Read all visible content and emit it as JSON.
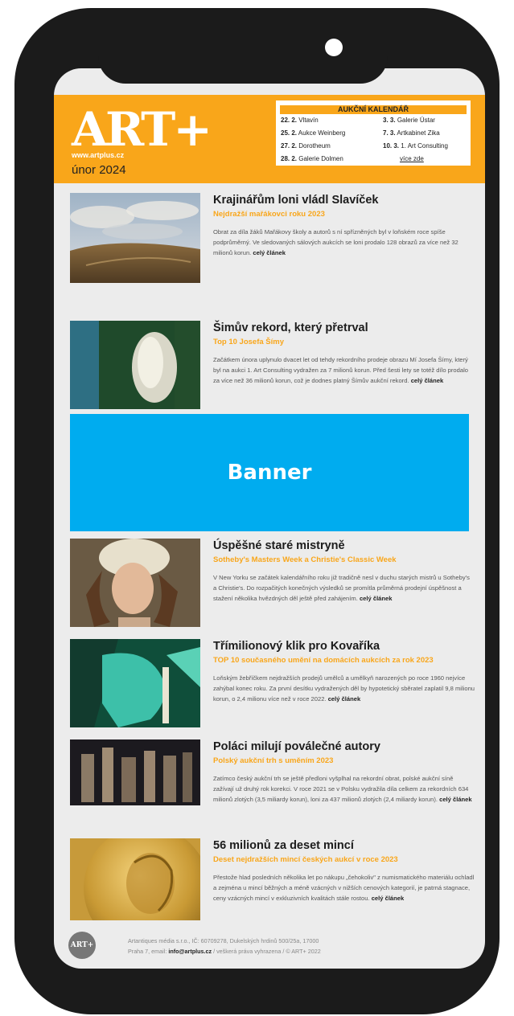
{
  "header": {
    "logo": "ART+",
    "url": "www.artplus.cz",
    "issue": "únor 2024"
  },
  "calendar": {
    "title": "AUKČNÍ KALENDÁŘ",
    "left": [
      {
        "date": "22. 2.",
        "house": "Vltavín"
      },
      {
        "date": "25. 2.",
        "house": "Aukce Weinberg"
      },
      {
        "date": "27. 2.",
        "house": "Dorotheum"
      },
      {
        "date": "28. 2.",
        "house": "Galerie Dolmen"
      }
    ],
    "right": [
      {
        "date": "3. 3.",
        "house": "Galerie Ústar"
      },
      {
        "date": "7. 3.",
        "house": "Artkabinet Zika"
      },
      {
        "date": "10. 3.",
        "house": "1. Art Consulting"
      }
    ],
    "more": "více zde"
  },
  "more_label": "celý článek",
  "articles": [
    {
      "title": "Krajinářům loni vládl Slavíček",
      "subtitle": "Nejdražší mařákovci roku 2023",
      "text": "Obrat za díla žáků Mařákovy školy a autorů s ní spřízněných byl v loňském roce spíše podprůměrný. Ve sledovaných sálových aukcích se loni prodalo 128 obrazů za více než 32 milionů korun."
    },
    {
      "title": "Šimův rekord, který přetrval",
      "subtitle": "Top 10 Josefa Šímy",
      "text": "Začátkem února uplynulo dvacet let od tehdy rekordního prodeje obrazu Mí Josefa Šímy, který byl na aukci 1. Art Consulting vydražen za 7 milionů korun. Před šesti lety se totéž dílo prodalo za více než 36 milionů korun, což je dodnes platný Šímův aukční rekord."
    },
    {
      "title": "Úspěšné staré mistryně",
      "subtitle": "Sotheby's Masters Week a Christie's Classic Week",
      "text": "V New Yorku se začátek kalendářního roku již tradičně nesl v duchu starých mistrů u Sotheby's a Christie's. Do rozpačitých konečných výsledků se promítla průměrná prodejní úspěšnost a stažení několika hvězdných děl ještě před zahájením."
    },
    {
      "title": "Třímilionový klik pro Kovaříka",
      "subtitle": "TOP 10 současného umění na domácích aukcích za rok 2023",
      "text": "Loňským žebříčkem nejdražších prodejů umělců a umělkyň narozených po roce 1960 nejvíce zahýbal konec roku. Za první desítku vydražených děl by hypotetický sběratel zaplatil 9,8 milionu korun, o 2,4 milionu více než v roce 2022."
    },
    {
      "title": "Poláci milují poválečné autory",
      "subtitle": "Polský aukční trh s uměním 2023",
      "text": "Zatímco český aukční trh se ještě předloni vyšplhal na rekordní obrat, polské aukční síně zažívají už druhý rok korekci. V roce 2021 se v Polsku vydražila díla celkem za rekordních 634 milionů zlotých (3,5 miliardy korun), loni za 437 milionů zlotých (2,4 miliardy korun)."
    },
    {
      "title": "56 milionů za deset mincí",
      "subtitle": "Deset nejdražších mincí českých aukcí v roce 2023",
      "text": "Přestože hlad posledních několika let po nákupu „čehokoliv\" z numismatického materiálu ochladl a zejména u mincí běžných a méně vzácných v nižších cenových kategorií, je patrná stagnace, ceny vzácných mincí v exkluzivních kvalitách stále rostou."
    }
  ],
  "banner": "Banner",
  "footer": {
    "logo": "ART+",
    "line1": "Artantiques média s.r.o., IČ: 60709278, Dukelských hrdinů 500/25a, 17000",
    "line2a": "Praha 7, email:",
    "email": "info@artplus.cz",
    "line2b": "/ veškerá práva vyhrazena / © ART+ 2022"
  }
}
